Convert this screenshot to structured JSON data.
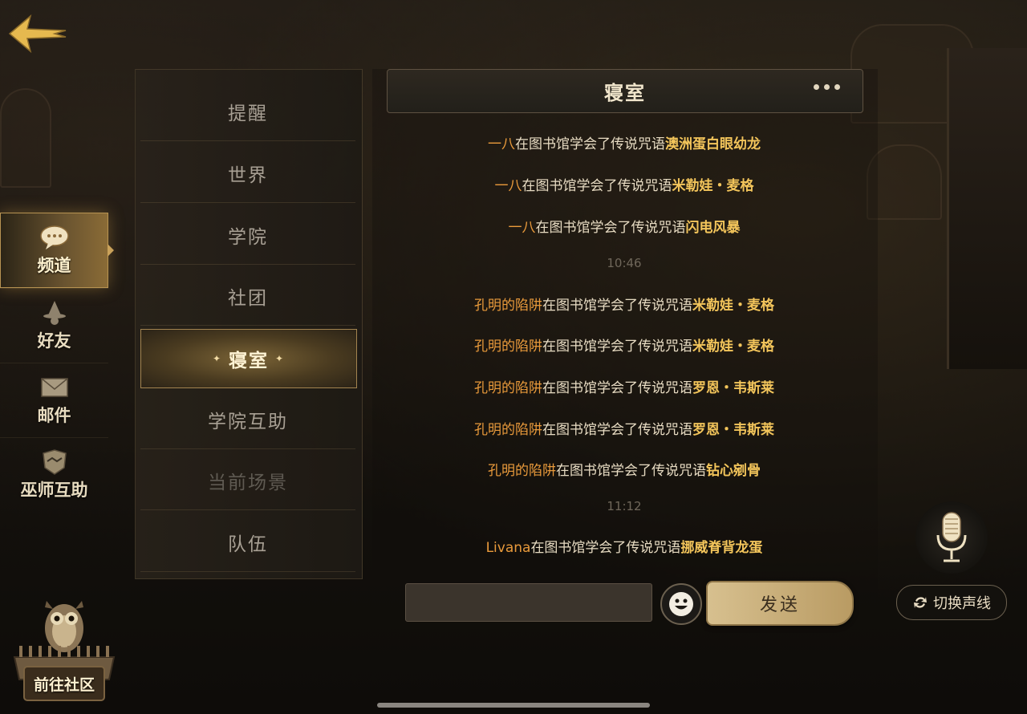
{
  "nav": {
    "back_icon": "back-arrow-icon",
    "items": [
      {
        "label": "频道",
        "icon": "chat-bubble-icon",
        "active": true
      },
      {
        "label": "好友",
        "icon": "wizard-hat-icon",
        "active": false
      },
      {
        "label": "邮件",
        "icon": "envelope-icon",
        "active": false
      },
      {
        "label": "巫师互助",
        "icon": "handshake-crest-icon",
        "active": false
      }
    ],
    "community_label": "前往社区"
  },
  "channels": [
    {
      "label": "提醒"
    },
    {
      "label": "世界"
    },
    {
      "label": "学院"
    },
    {
      "label": "社团"
    },
    {
      "label": "寝室",
      "active": true
    },
    {
      "label": "学院互助"
    },
    {
      "label": "当前场景",
      "dim": true
    },
    {
      "label": "队伍"
    }
  ],
  "chat": {
    "title": "寝室",
    "messages": [
      {
        "user": "一八",
        "text": "在图书馆学会了传说咒语",
        "spell": "澳洲蛋白眼幼龙"
      },
      {
        "user": "一八",
        "text": "在图书馆学会了传说咒语",
        "spell": "米勒娃・麦格"
      },
      {
        "user": "一八",
        "text": "在图书馆学会了传说咒语",
        "spell": "闪电风暴"
      },
      {
        "user": "孔明的陷阱",
        "text": "在图书馆学会了传说咒语",
        "spell": "米勒娃・麦格"
      },
      {
        "user": "孔明的陷阱",
        "text": "在图书馆学会了传说咒语",
        "spell": "米勒娃・麦格"
      },
      {
        "user": "孔明的陷阱",
        "text": "在图书馆学会了传说咒语",
        "spell": "罗恩・韦斯莱"
      },
      {
        "user": "孔明的陷阱",
        "text": "在图书馆学会了传说咒语",
        "spell": "罗恩・韦斯莱"
      },
      {
        "user": "孔明的陷阱",
        "text": "在图书馆学会了传说咒语",
        "spell": "钻心剜骨"
      },
      {
        "user": "Livana",
        "text": "在图书馆学会了传说咒语",
        "spell": "挪威脊背龙蛋"
      }
    ],
    "times": [
      "10:46",
      "11:12"
    ],
    "input_placeholder": "",
    "send_label": "发送"
  },
  "voice": {
    "mic_icon": "microphone-icon",
    "switch_label": "切换声线",
    "switch_icon": "refresh-icon"
  },
  "colors": {
    "username": "#e99a3b",
    "spell": "#f3c55b",
    "accent_gold": "#caa25a"
  }
}
